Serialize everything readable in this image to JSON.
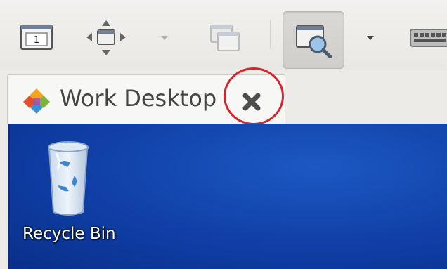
{
  "toolbar": {
    "buttons": [
      {
        "icon": "single-monitor-icon",
        "label": "1"
      },
      {
        "icon": "move-arrows-icon"
      },
      {
        "icon": "dropdown-arrow-icon"
      },
      {
        "icon": "windows-stack-icon"
      },
      {
        "icon": "window-zoom-icon"
      },
      {
        "icon": "dropdown-arrow-icon"
      },
      {
        "icon": "keyboard-icon"
      }
    ]
  },
  "tabs": [
    {
      "title": "Work Desktop",
      "icon": "vmware-logo-icon",
      "close_icon": "close-icon"
    }
  ],
  "highlight": {
    "color": "#d8232a"
  },
  "desktop": {
    "background": "#0f3fa6",
    "icons": [
      {
        "label": "Recycle Bin",
        "icon": "recycle-bin-icon"
      }
    ]
  }
}
